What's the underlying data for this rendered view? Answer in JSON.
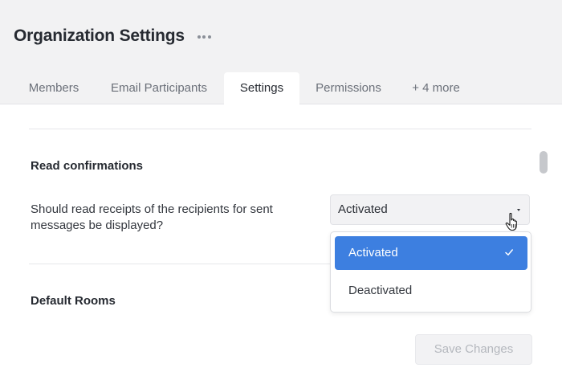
{
  "header": {
    "title": "Organization Settings"
  },
  "tabs": [
    {
      "label": "Members",
      "active": false
    },
    {
      "label": "Email Participants",
      "active": false
    },
    {
      "label": "Settings",
      "active": true
    },
    {
      "label": "Permissions",
      "active": false
    },
    {
      "label": "+ 4 more",
      "active": false
    }
  ],
  "sections": {
    "read_confirmations": {
      "title": "Read confirmations",
      "question": "Should read receipts of the recipients for sent messages be displayed?",
      "select": {
        "value": "Activated",
        "options": [
          {
            "label": "Activated",
            "selected": true
          },
          {
            "label": "Deactivated",
            "selected": false
          }
        ]
      }
    },
    "default_rooms": {
      "title": "Default Rooms"
    }
  },
  "actions": {
    "save_label": "Save Changes",
    "save_disabled": true
  },
  "icons": {
    "more": "more-horizontal-icon",
    "caret": "caret-down-icon",
    "check": "check-icon",
    "cursor": "hand-pointer-icon"
  },
  "colors": {
    "header_bg": "#f2f2f3",
    "accent": "#3d7fe0",
    "disabled_text": "#b5b8be"
  }
}
